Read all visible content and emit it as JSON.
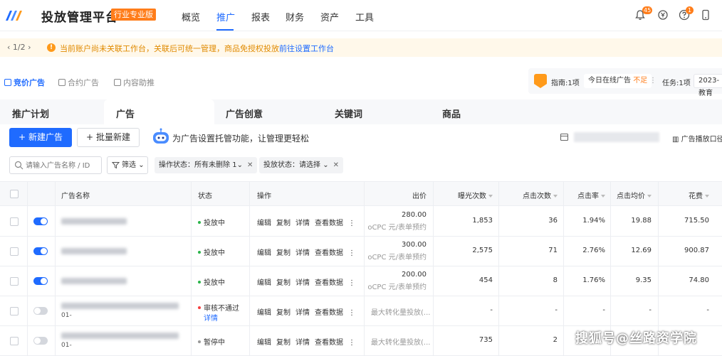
{
  "app": {
    "title": "投放管理平台",
    "edition": "行业专业版"
  },
  "nav": {
    "items": [
      "概览",
      "推广",
      "报表",
      "财务",
      "资产",
      "工具"
    ],
    "active": "推广"
  },
  "topbar": {
    "bell_badge": "45",
    "help_badge": "1"
  },
  "notice": {
    "pager": "1/2",
    "text": "当前账户尚未关联工作台，关联后可统一管理，商品免授权投放",
    "link": "前往设置工作台"
  },
  "type_tabs": [
    "竞价广告",
    "合约广告",
    "内容助推"
  ],
  "guide": {
    "guide_text": "指南:1项",
    "online_label": "今日在线广告",
    "online_status": "不足",
    "task_text": "任务:1项",
    "year_select": "2023-教育"
  },
  "sub_tabs": [
    "推广计划",
    "广告",
    "广告创意",
    "关键词",
    "商品"
  ],
  "toolbar": {
    "new_label": "新建广告",
    "batch_label": "批量新建",
    "promo": "为广告设置托管功能，让管理更轻松",
    "export_label": "广告播放口径"
  },
  "filters": {
    "search_placeholder": "请输入广告名称 / ID",
    "filter_label": "筛选",
    "chip1": "操作状态：所有未删除",
    "chip1_count": "1",
    "chip2": "投放状态：请选择"
  },
  "table": {
    "headers": {
      "name": "广告名称",
      "status": "状态",
      "ops": "操作",
      "bid": "出价",
      "impr": "曝光次数",
      "clicks": "点击次数",
      "ctr": "点击率",
      "cpc": "点击均价",
      "cost": "花费"
    },
    "op_labels": [
      "编辑",
      "复制",
      "详情",
      "查看数据",
      "⋮"
    ],
    "rows": [
      {
        "toggle": "on",
        "status": "投放中",
        "bid": "280.00",
        "bid_unit": "oCPC 元/表单预约",
        "impr": "1,853",
        "clicks": "36",
        "ctr": "1.94%",
        "cpc": "19.88",
        "cost": "715.50"
      },
      {
        "toggle": "on",
        "status": "投放中",
        "bid": "300.00",
        "bid_unit": "oCPC 元/表单预约",
        "impr": "2,575",
        "clicks": "71",
        "ctr": "2.76%",
        "cpc": "12.69",
        "cost": "900.87"
      },
      {
        "toggle": "on",
        "status": "投放中",
        "bid": "200.00",
        "bid_unit": "oCPC 元/表单预约",
        "impr": "454",
        "clicks": "8",
        "ctr": "1.76%",
        "cpc": "9.35",
        "cost": "74.80"
      },
      {
        "toggle": "off",
        "status": "审核不通过",
        "status_link": "详情",
        "name_suffix": "01-",
        "bid_text": "最大转化量投放(...",
        "impr": "-",
        "clicks": "-",
        "ctr": "-",
        "cpc": "-",
        "cost": "-"
      },
      {
        "toggle": "off",
        "status": "暂停中",
        "name_suffix": "01-",
        "bid_text": "最大转化量投放(...",
        "impr": "735",
        "clicks": "2",
        "ctr": "",
        "cpc": "",
        "cost": ""
      }
    ]
  },
  "colors": {
    "accent": "#1f6bff",
    "warning": "#ff7d1a",
    "running": "#2bb44a",
    "rejected": "#f53f3f",
    "paused": "#999999"
  },
  "watermark": "搜狐号@丝路资学院"
}
